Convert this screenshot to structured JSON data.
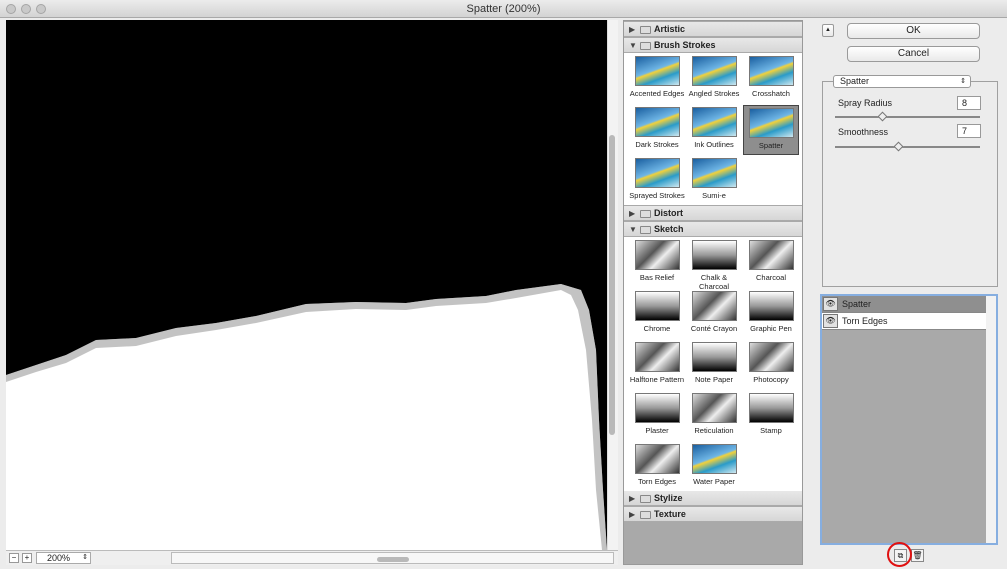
{
  "window": {
    "title": "Spatter (200%)"
  },
  "preview": {
    "zoom": "200%"
  },
  "filters": {
    "categories": [
      {
        "label": "Artistic",
        "expanded": false
      },
      {
        "label": "Brush Strokes",
        "expanded": true,
        "items": [
          "Accented Edges",
          "Angled Strokes",
          "Crosshatch",
          "Dark Strokes",
          "Ink Outlines",
          "Spatter",
          "Sprayed Strokes",
          "Sumi-e"
        ],
        "selected": "Spatter"
      },
      {
        "label": "Distort",
        "expanded": false
      },
      {
        "label": "Sketch",
        "expanded": true,
        "items": [
          "Bas Relief",
          "Chalk & Charcoal",
          "Charcoal",
          "Chrome",
          "Conté Crayon",
          "Graphic Pen",
          "Halftone Pattern",
          "Note Paper",
          "Photocopy",
          "Plaster",
          "Reticulation",
          "Stamp",
          "Torn Edges",
          "Water Paper"
        ]
      },
      {
        "label": "Stylize",
        "expanded": false
      },
      {
        "label": "Texture",
        "expanded": false
      }
    ]
  },
  "controls": {
    "ok": "OK",
    "cancel": "Cancel",
    "filter_select": "Spatter",
    "params": [
      {
        "label": "Spray Radius",
        "value": "8",
        "fraction": 0.33
      },
      {
        "label": "Smoothness",
        "value": "7",
        "fraction": 0.44
      }
    ]
  },
  "layers": [
    {
      "name": "Spatter",
      "selected": true
    },
    {
      "name": "Torn Edges",
      "selected": false
    }
  ],
  "colors": {
    "accent": "#86aee0",
    "highlight_circle": "#e01010"
  }
}
